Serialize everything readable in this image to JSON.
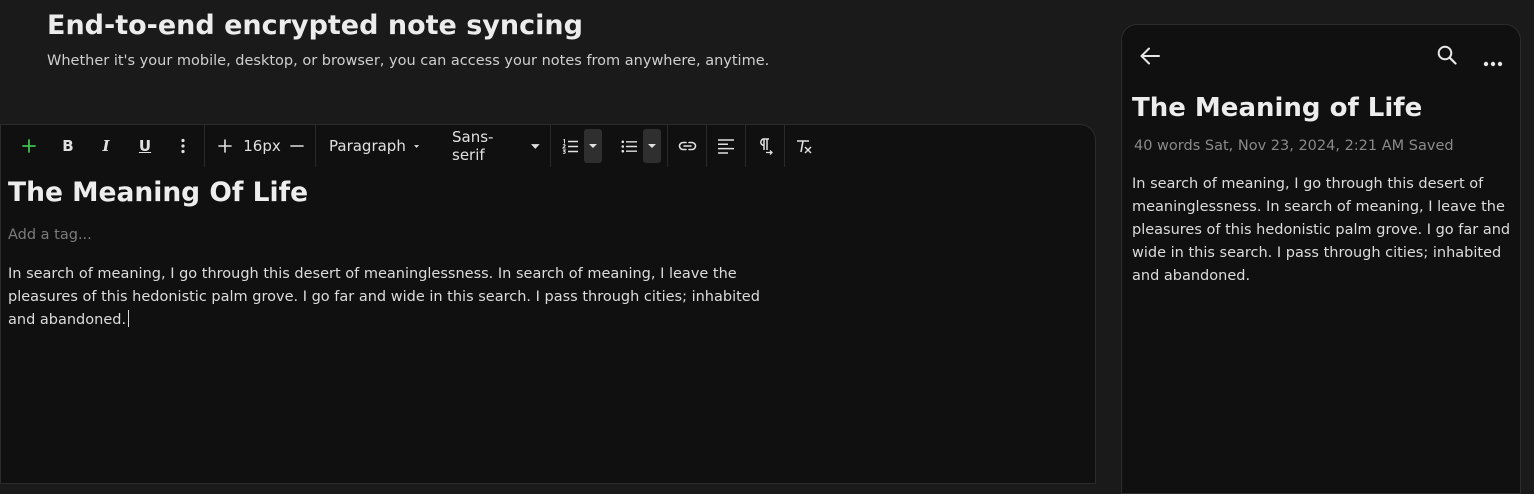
{
  "hero": {
    "title": "End-to-end encrypted note syncing",
    "subtitle": "Whether it's your mobile, desktop, or browser, you can access your notes from anywhere, anytime."
  },
  "toolbar": {
    "add_icon": "plus-icon",
    "bold": "B",
    "italic": "I",
    "underline": "U",
    "more_icon": "vertical-dots-icon",
    "font_size": "16px",
    "block_type": "Paragraph",
    "font_family": "Sans-serif",
    "accent_color": "#3fbf4f"
  },
  "editor": {
    "title": "The Meaning Of Life",
    "tag_placeholder": "Add a tag...",
    "body": "In search of meaning, I go through this desert of meaninglessness. In search of meaning, I leave the pleasures of this hedonistic palm grove. I go far and wide in this search. I pass through cities; inhabited and abandoned."
  },
  "mobile": {
    "title": "The Meaning of Life",
    "word_count": "40 words",
    "date": "Sat, Nov 23, 2024, 2:21 AM",
    "status": "Saved",
    "body": "In search of meaning, I go through this desert of meaninglessness. In search of meaning, I leave the pleasures of this hedonistic palm grove. I go far and wide in this search. I pass through cities; inhabited and abandoned."
  }
}
